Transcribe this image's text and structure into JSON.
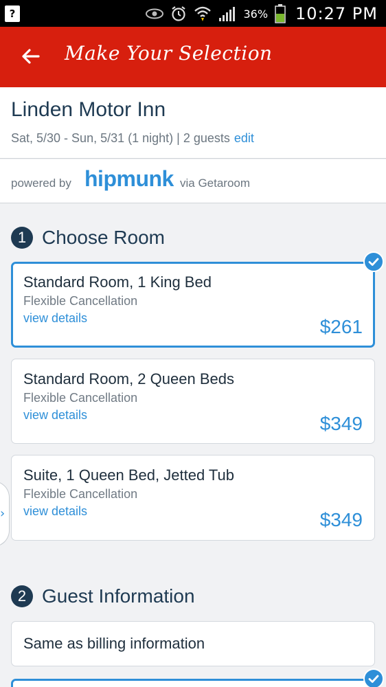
{
  "status_bar": {
    "notification_glyph": "?",
    "battery_percent": "36%",
    "time": "10:27 PM",
    "icons": [
      "eye-icon",
      "alarm-icon",
      "wifi-icon",
      "signal-icon",
      "battery-icon"
    ]
  },
  "toolbar": {
    "title": "Make Your Selection",
    "back_icon": "back-arrow-icon",
    "color": "#d71f0e"
  },
  "hotel": {
    "name": "Linden Motor Inn",
    "dates": "Sat, 5/30 - Sun, 5/31 (1 night) | 2 guests",
    "edit_label": "edit"
  },
  "powered": {
    "prefix": "powered by",
    "brand": "hipmunk",
    "suffix": "via Getaroom"
  },
  "section1": {
    "number": "1",
    "title": "Choose Room",
    "rooms": [
      {
        "name": "Standard Room, 1 King Bed",
        "cancellation": "Flexible Cancellation",
        "details_label": "view details",
        "price": "$261",
        "selected": true
      },
      {
        "name": "Standard Room, 2 Queen Beds",
        "cancellation": "Flexible Cancellation",
        "details_label": "view details",
        "price": "$349",
        "selected": false
      },
      {
        "name": "Suite, 1 Queen Bed, Jetted Tub",
        "cancellation": "Flexible Cancellation",
        "details_label": "view details",
        "price": "$349",
        "selected": false
      }
    ]
  },
  "section2": {
    "number": "2",
    "title": "Guest Information",
    "billing_label": "Same as billing information"
  },
  "side_tab": {
    "chevron": "›"
  },
  "colors": {
    "accent": "#2e8fd8",
    "heading": "#1e3a52",
    "toolbar": "#d71f0e"
  }
}
